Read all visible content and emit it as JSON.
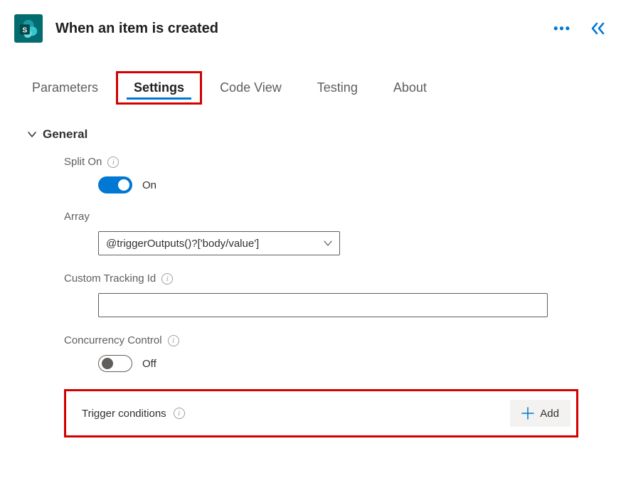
{
  "header": {
    "title": "When an item is created"
  },
  "tabs": [
    {
      "label": "Parameters",
      "active": false
    },
    {
      "label": "Settings",
      "active": true
    },
    {
      "label": "Code View",
      "active": false
    },
    {
      "label": "Testing",
      "active": false
    },
    {
      "label": "About",
      "active": false
    }
  ],
  "section": {
    "title": "General",
    "split_on": {
      "label": "Split On",
      "state": "On"
    },
    "array": {
      "label": "Array",
      "value": "@triggerOutputs()?['body/value']"
    },
    "custom_tracking": {
      "label": "Custom Tracking Id",
      "value": ""
    },
    "concurrency": {
      "label": "Concurrency Control",
      "state": "Off"
    },
    "trigger_conditions": {
      "label": "Trigger conditions",
      "add_label": "Add"
    }
  }
}
